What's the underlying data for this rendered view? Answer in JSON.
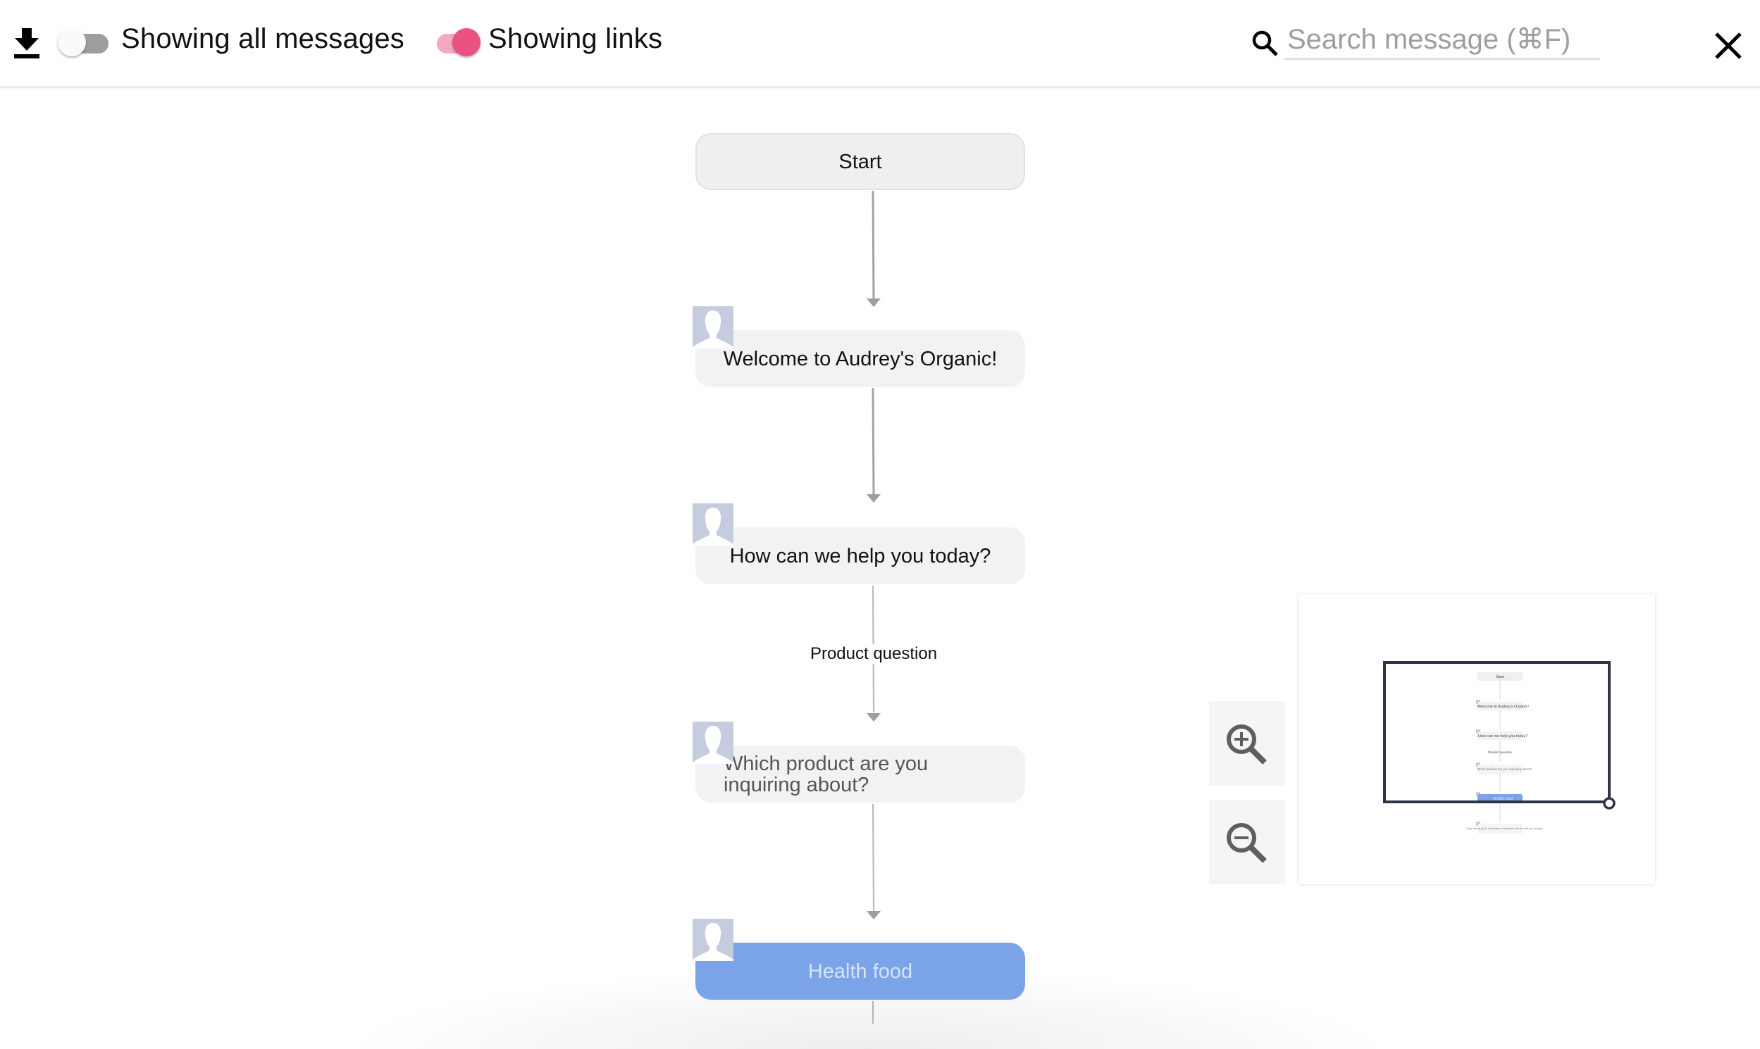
{
  "header": {
    "download_icon": "download-icon",
    "toggles": [
      {
        "label": "Showing all messages",
        "on": false
      },
      {
        "label": "Showing links",
        "on": true
      }
    ],
    "search": {
      "placeholder": "Search message (⌘F)",
      "value": "",
      "icon": "search-icon"
    },
    "close_icon": "close-icon"
  },
  "colors": {
    "accent": "#ea5282",
    "accent_track": "#f4a9c0",
    "selected_node": "#7ba4e8",
    "node_bg": "#f1f2f4",
    "edge": "#9e9e9e",
    "minimap_frame": "#2f3446"
  },
  "flow": {
    "nodes": [
      {
        "id": "start",
        "text": "Start",
        "type": "start",
        "avatar": false
      },
      {
        "id": "welcome",
        "text": "Welcome to Audrey's Organic!",
        "type": "message",
        "avatar": true
      },
      {
        "id": "help",
        "text": "How can we help you today?",
        "type": "message",
        "avatar": true
      },
      {
        "id": "which-product",
        "text": "Which product are you inquiring about?",
        "type": "message",
        "avatar": true
      },
      {
        "id": "health-food",
        "text": "Health food",
        "type": "option",
        "avatar": true,
        "selected": true
      }
    ],
    "edges": [
      {
        "from": "start",
        "to": "welcome",
        "label": ""
      },
      {
        "from": "welcome",
        "to": "help",
        "label": ""
      },
      {
        "from": "help",
        "to": "which-product",
        "label": "Product question"
      },
      {
        "from": "which-product",
        "to": "health-food",
        "label": ""
      },
      {
        "from": "health-food",
        "to": "okay",
        "label": ""
      }
    ]
  },
  "zoom_controls": {
    "zoom_in_icon": "zoom-in-icon",
    "zoom_out_icon": "zoom-out-icon"
  },
  "minimap": {
    "nodes": [
      "Start",
      "Welcome to Audrey's Organic!",
      "How can we help you today?",
      "Product question",
      "Which product are you inquiring about?",
      "Health food",
      "Okay, we've got it. A member of our team will be with you shortly!"
    ]
  }
}
